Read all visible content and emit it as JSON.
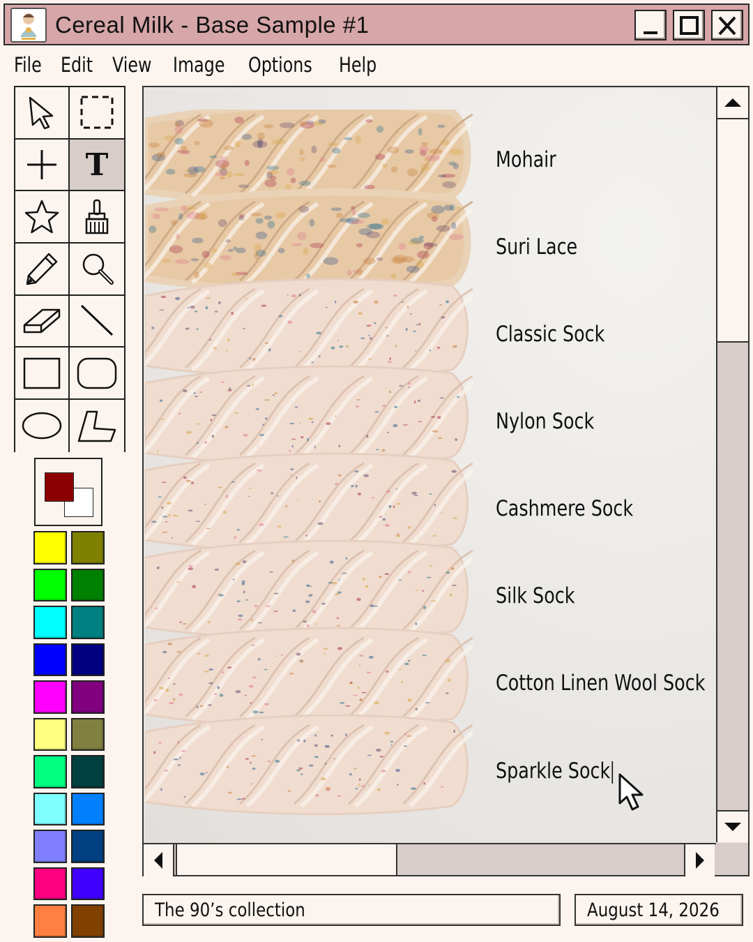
{
  "window": {
    "title": "Cereal Milk - Base Sample #1",
    "title_bar_color": "#d6a6a8"
  },
  "menu": [
    "File",
    "Edit",
    "View",
    "Image",
    "Options",
    "Help"
  ],
  "tools": [
    {
      "icon": "select-arrow-icon"
    },
    {
      "icon": "marquee-select-icon"
    },
    {
      "icon": "crosshair-icon"
    },
    {
      "icon": "text-tool-icon",
      "label": "T",
      "active": true
    },
    {
      "icon": "star-shape-icon"
    },
    {
      "icon": "paint-brush-icon"
    },
    {
      "icon": "pencil-icon"
    },
    {
      "icon": "magnifier-icon"
    },
    {
      "icon": "eraser-icon"
    },
    {
      "icon": "line-tool-icon"
    },
    {
      "icon": "rectangle-tool-icon"
    },
    {
      "icon": "rounded-rectangle-tool-icon"
    },
    {
      "icon": "ellipse-tool-icon"
    },
    {
      "icon": "polygon-tool-icon"
    }
  ],
  "colors": {
    "foreground": "#8b0000",
    "background": "#ffffff",
    "palette": [
      "#ffff00",
      "#808000",
      "#00ff00",
      "#008000",
      "#00ffff",
      "#008080",
      "#0000ff",
      "#000080",
      "#ff00ff",
      "#800080",
      "#ffff80",
      "#808040",
      "#00ff80",
      "#004040",
      "#80ffff",
      "#0080ff",
      "#8080ff",
      "#004080",
      "#ff0080",
      "#4000ff",
      "#ff8040",
      "#804000"
    ]
  },
  "canvas": {
    "yarn_labels": [
      "Mohair",
      "Suri Lace",
      "Classic Sock",
      "Nylon Sock",
      "Cashmere Sock",
      "Silk Sock",
      "Cotton Linen Wool Sock",
      "Sparkle Sock"
    ]
  },
  "status": {
    "collection": "The 90’s collection",
    "date": "August 14, 2026"
  }
}
